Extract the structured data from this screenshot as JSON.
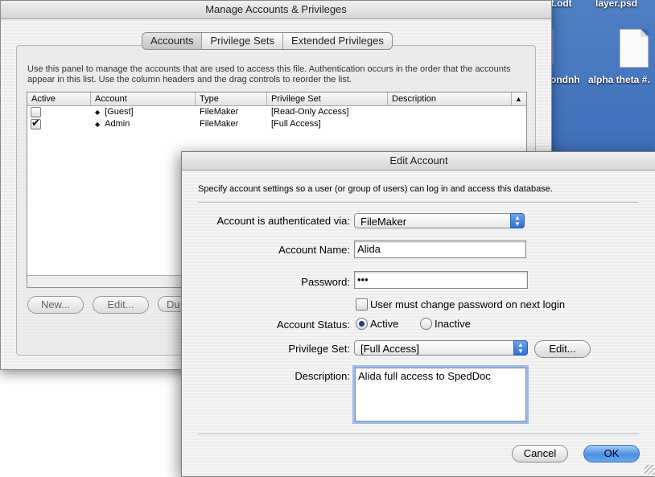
{
  "desktop": {
    "items": [
      "ct.odt",
      "layer.psd",
      "ondnh",
      "alpha theta #."
    ]
  },
  "manage_window": {
    "title": "Manage Accounts & Privileges",
    "tabs": [
      "Accounts",
      "Privilege Sets",
      "Extended Privileges"
    ],
    "selected_tab": "Accounts",
    "info_text": "Use this panel to manage the accounts that are used to access this file.  Authentication occurs in the order that the accounts appear in this list.  Use the column headers and the drag controls to reorder the list.",
    "columns": [
      "Active",
      "Account",
      "Type",
      "Privilege Set",
      "Description"
    ],
    "rows": [
      {
        "active": false,
        "account": "[Guest]",
        "type": "FileMaker",
        "privilege_set": "[Read-Only Access]",
        "description": ""
      },
      {
        "active": true,
        "account": "Admin",
        "type": "FileMaker",
        "privilege_set": "[Full Access]",
        "description": ""
      }
    ],
    "buttons": {
      "new": "New...",
      "edit": "Edit...",
      "duplicate": "Du"
    }
  },
  "edit_dialog": {
    "title": "Edit Account",
    "description": "Specify account settings so a user (or group of users) can log in and access this database.",
    "auth_label": "Account is authenticated via:",
    "auth_value": "FileMaker",
    "name_label": "Account Name:",
    "name_value": "Alida",
    "password_label": "Password:",
    "password_value": "•••",
    "must_change_label": "User must change password on next login",
    "must_change_checked": false,
    "status_label": "Account Status:",
    "status_active": "Active",
    "status_inactive": "Inactive",
    "status_selected": "Active",
    "privset_label": "Privilege Set:",
    "privset_value": "[Full Access]",
    "privset_edit": "Edit...",
    "desc_label": "Description:",
    "desc_value": "Alida full access to SpedDoc",
    "cancel": "Cancel",
    "ok": "OK"
  },
  "colors": {
    "accent_blue": "#4b8fe3",
    "desktop_blue": "#3a6cb8"
  }
}
